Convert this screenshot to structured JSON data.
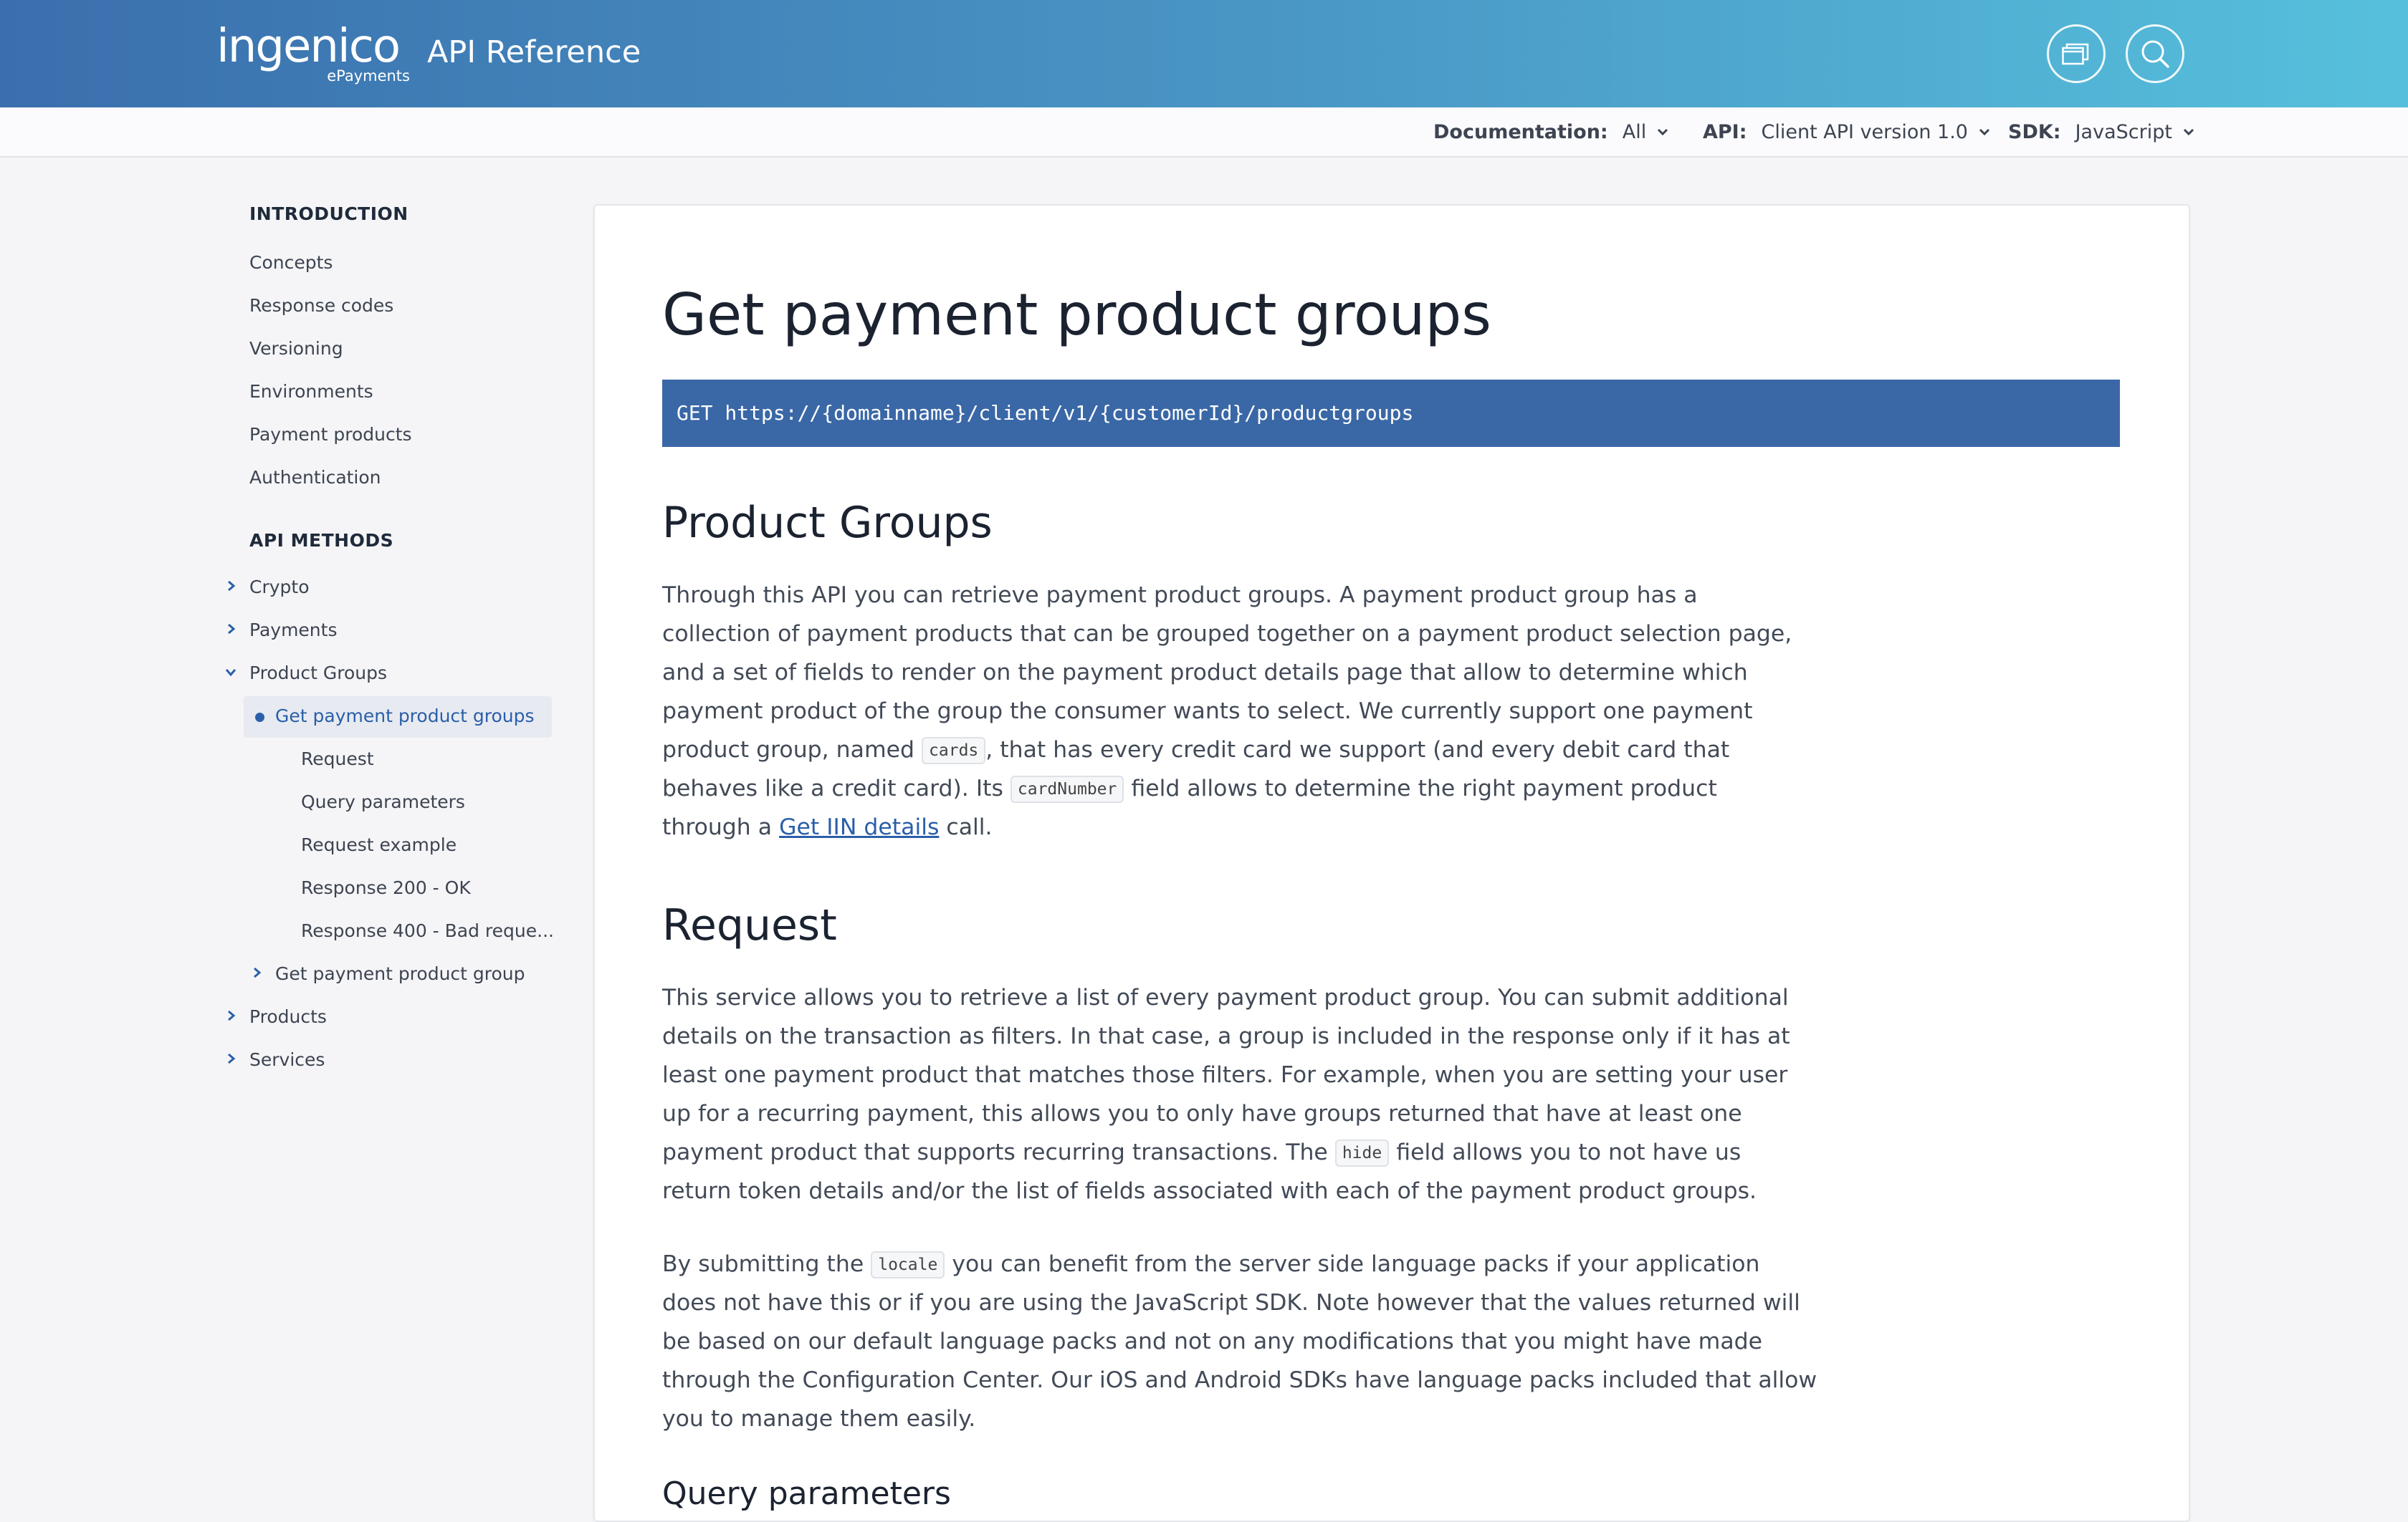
{
  "header": {
    "logo_text": "ingenico",
    "logo_subtext": "ePayments",
    "title": "API Reference",
    "buttons": [
      "windows-icon",
      "search-icon"
    ]
  },
  "filters": {
    "documentation": {
      "label": "Documentation:",
      "value": "All"
    },
    "api": {
      "label": "API:",
      "value": "Client API version 1.0"
    },
    "sdk": {
      "label": "SDK:",
      "value": "JavaScript"
    }
  },
  "sidebar": {
    "intro_heading": "INTRODUCTION",
    "intro_items": [
      "Concepts",
      "Response codes",
      "Versioning",
      "Environments",
      "Payment products",
      "Authentication"
    ],
    "methods_heading": "API METHODS",
    "methods": [
      "Crypto",
      "Payments",
      "Product Groups",
      "Get payment product groups",
      "Request",
      "Query parameters",
      "Request example",
      "Response 200 - OK",
      "Response 400 - Bad reque...",
      "Get payment product group",
      "Products",
      "Services"
    ]
  },
  "content": {
    "title": "Get payment product groups",
    "endpoint": "GET https://{domainname}/client/v1/{customerId}/productgroups",
    "section1": {
      "heading": "Product Groups",
      "lines": [
        "Through this API you can retrieve payment product groups. A payment product group has a",
        "collection of payment products that can be grouped together on a payment product selection page,",
        "and a set of fields to render on the payment product details page that allow to determine which",
        "payment product of the group the consumer wants to select. We currently support one payment"
      ],
      "l5_a": "product group, named ",
      "l5_code": "cards",
      "l5_b": ", that has every credit card we support (and every debit card that",
      "l6_a": "behaves like a credit card). Its ",
      "l6_code": "cardNumber",
      "l6_b": " field allows to determine the right payment product",
      "l7_a": "through a ",
      "l7_link": "Get IIN details",
      "l7_b": " call."
    },
    "section2": {
      "heading": "Request",
      "lines": [
        "This service allows you to retrieve a list of every payment product group. You can submit additional",
        "details on the transaction as filters. In that case, a group is included in the response only if it has at",
        "least one payment product that matches those filters. For example, when you are setting your user",
        "up for a recurring payment, this allows you to only have groups returned that have at least one"
      ],
      "l5_a": "payment product that supports recurring transactions. The ",
      "l5_code": "hide",
      "l5_b": " field allows you to not have us",
      "l6": "return token details and/or the list of fields associated with each of the payment product groups.",
      "p2_l1_a": "By submitting the ",
      "p2_l1_code": "locale",
      "p2_l1_b": " you can benefit from the server side language packs if your application",
      "p2_lines": [
        "does not have this or if you are using the JavaScript SDK. Note however that the values returned will",
        "be based on our default language packs and not on any modifications that you might have made",
        "through the Configuration Center. Our iOS and Android SDKs have language packs included that allow",
        "you to manage them easily."
      ]
    },
    "section3": {
      "heading": "Query parameters"
    }
  },
  "colors": {
    "header_gradient_start": "#3a6fad",
    "header_gradient_end": "#56c0dc",
    "endpoint_bg": "#3a67a6",
    "active_item_bg": "#e7eaf1",
    "link": "#2a5fa8"
  }
}
